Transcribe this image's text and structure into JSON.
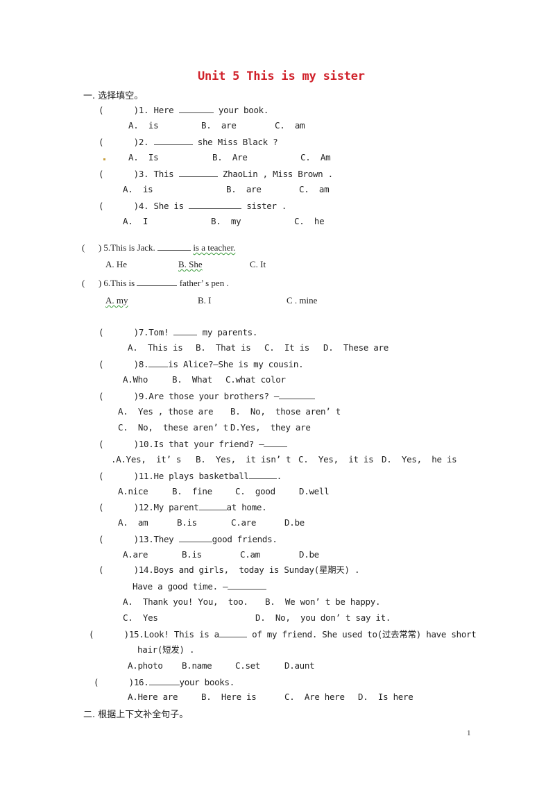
{
  "document": {
    "title": "Unit 5 This is my sister",
    "page_number": "1"
  },
  "sections": [
    {
      "label": "一. 选择填空。"
    },
    {
      "label": "二. 根据上下文补全句子。"
    }
  ],
  "paren": "(      )",
  "questions": [
    {
      "num": "1.",
      "before": "Here",
      "after": "your book.",
      "options": [
        "A.  is",
        "B.  are",
        "C.  am"
      ]
    },
    {
      "num": "2.",
      "before": "",
      "after": "she Miss Black ?",
      "options": [
        "A.  Is",
        "B.  Are",
        "C.  Am"
      ]
    },
    {
      "num": "3.",
      "before": "This",
      "after": "ZhaoLin , Miss Brown .",
      "options": [
        "A.  is",
        "B.  are",
        "C.  am"
      ]
    },
    {
      "num": "4.",
      "before": "She is",
      "after": "sister .",
      "options": [
        "A.  I",
        "B.  my",
        "C.  he"
      ]
    },
    {
      "num": "5.",
      "before": "This is Jack.",
      "after": "is a teacher.",
      "options": [
        "A. He",
        "B. She",
        "C. It"
      ]
    },
    {
      "num": "6.",
      "before": "This is",
      "after": "father’ s pen .",
      "options": [
        "A. my",
        "B. I",
        "C . mine"
      ]
    },
    {
      "num": "7.",
      "before": "Tom!",
      "after": "my parents.",
      "options": [
        "A.  This is",
        "B.  That is",
        "C.  It is",
        "D.  These are"
      ]
    },
    {
      "num": "8.",
      "before": "",
      "after": "is Alice?—She is my cousin.",
      "options": [
        "A.Who",
        "B.  What",
        "C.what color"
      ]
    },
    {
      "num": "9.",
      "before": "Are those your brothers? —",
      "after": "",
      "options": [
        "A.  Yes , those are",
        "B.  No,  those aren’ t",
        "C.  No,  these aren’ t",
        "D.Yes,  they are"
      ]
    },
    {
      "num": "10.",
      "before": "Is that your friend? —",
      "after": "",
      "options": [
        ".A.Yes,  it’ s",
        "B.  Yes,  it isn’ t",
        "C.  Yes,  it is",
        "D.  Yes,  he is"
      ]
    },
    {
      "num": "11.",
      "before": "He plays basketball",
      "after": ".",
      "options": [
        "A.nice",
        "B.  fine",
        "C.  good",
        "D.well"
      ]
    },
    {
      "num": "12.",
      "before": "My parent",
      "after": "at home.",
      "options": [
        "A.  am",
        "B.is",
        "C.are",
        "D.be"
      ]
    },
    {
      "num": "13.",
      "before": "They",
      "after": "good friends.",
      "options": [
        "A.are",
        "B.is",
        "C.am",
        "D.be"
      ]
    },
    {
      "num": "14.",
      "before": "Boys and girls,  today is Sunday(星期天) .",
      "line2_before": "Have a good time. —",
      "after": "",
      "options": [
        "A.  Thank you! You,  too.",
        "B.  We won’ t be happy.",
        "C.  Yes",
        "D.  No,  you don’ t say it."
      ]
    },
    {
      "num": "15.",
      "before": "Look! This is a",
      "after": " of my friend. She used to(过去常常) have short",
      "line2": "hair(短发) .",
      "options": [
        "A.photo",
        "B.name",
        "C.set",
        "D.aunt"
      ]
    },
    {
      "num": "16.",
      "before": "",
      "after": "your books.",
      "options": [
        "A.Here are",
        "B.  Here is",
        "C.  Are here",
        "D.  Is here"
      ]
    }
  ]
}
